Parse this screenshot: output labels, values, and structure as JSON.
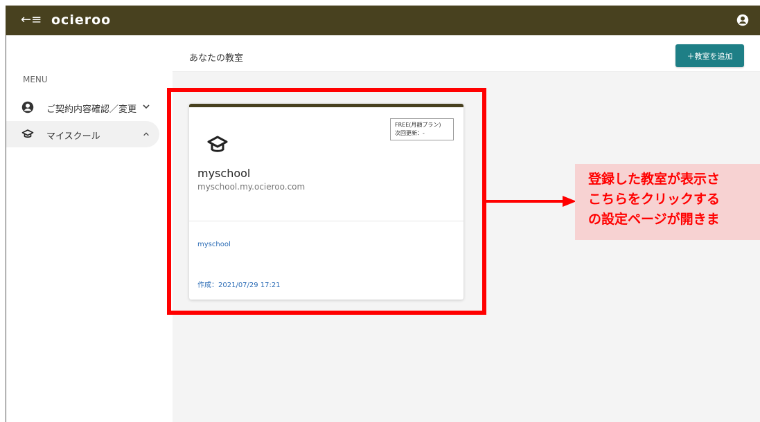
{
  "topbar": {
    "back_icon": "←≡",
    "logo": "ocieroo",
    "user_icon": "account-circle-icon",
    "bg_color": "#48411f"
  },
  "sidebar": {
    "menu_title": "MENU",
    "items": [
      {
        "icon": "account-circle-icon",
        "label": "ご契約内容確認／変更",
        "chevron": "chevron-down-icon"
      },
      {
        "icon": "graduation-cap-icon",
        "label": "マイスクール",
        "chevron": "chevron-up-icon"
      }
    ]
  },
  "main": {
    "title": "あなたの教室",
    "add_button": "＋教室を追加",
    "accent_color": "#1e7f86"
  },
  "card": {
    "plan_line1": "FREE(月額プラン)",
    "plan_line2": "次回更新：-",
    "name": "myschool",
    "domain": "myschool.my.ocieroo.com",
    "link": "myschool",
    "created": "作成：2021/07/29 17:21"
  },
  "callout": {
    "line1": "登録した教室が表示さ",
    "line2": "こちらをクリックする",
    "line3": "の設定ページが開きま",
    "highlight_color": "#ff0000"
  }
}
